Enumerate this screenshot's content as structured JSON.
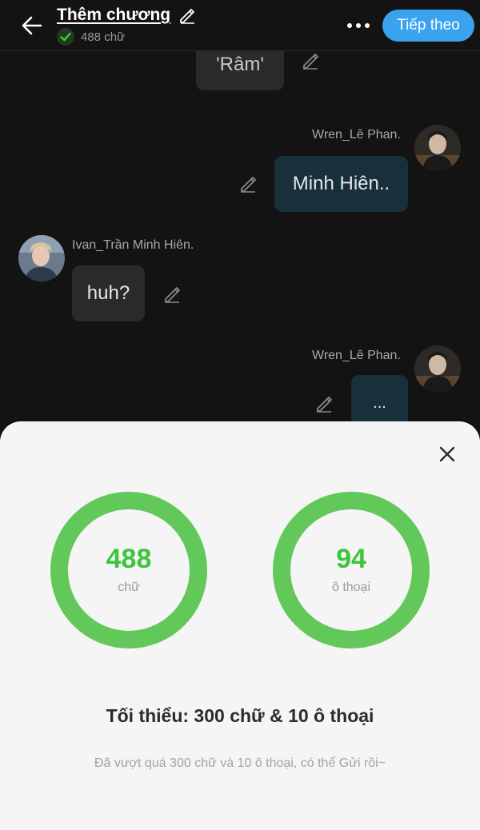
{
  "header": {
    "title": "Thêm chương",
    "word_count": "488 chữ",
    "next_label": "Tiếp theo"
  },
  "chat": {
    "messages": [
      {
        "text": "'Râm'",
        "side": "right",
        "style": "gray"
      },
      {
        "speaker": "Wren_Lê Phan.",
        "text": "Minh Hiên..",
        "side": "right",
        "style": "teal"
      },
      {
        "speaker": "Ivan_Trần Minh Hiên.",
        "text": "huh?",
        "side": "left",
        "style": "gray"
      },
      {
        "speaker": "Wren_Lê Phan.",
        "text": "...",
        "side": "right",
        "style": "teal"
      }
    ]
  },
  "stats": {
    "words": {
      "value": "488",
      "label": "chữ",
      "progress": 1.0
    },
    "dialogs": {
      "value": "94",
      "label": "ô thoại",
      "progress": 1.0
    },
    "requirement": "Tối thiểu: 300 chữ & 10 ô thoại",
    "note": "Đã vượt quá 300 chữ và 10 ô thoại, có thể Gửi rồi~"
  },
  "colors": {
    "accent_blue": "#3aa3f0",
    "ring_green": "#63c85a",
    "value_green": "#3cc43c",
    "bubble_teal": "#18303a",
    "bubble_gray": "#2a2a2a"
  }
}
